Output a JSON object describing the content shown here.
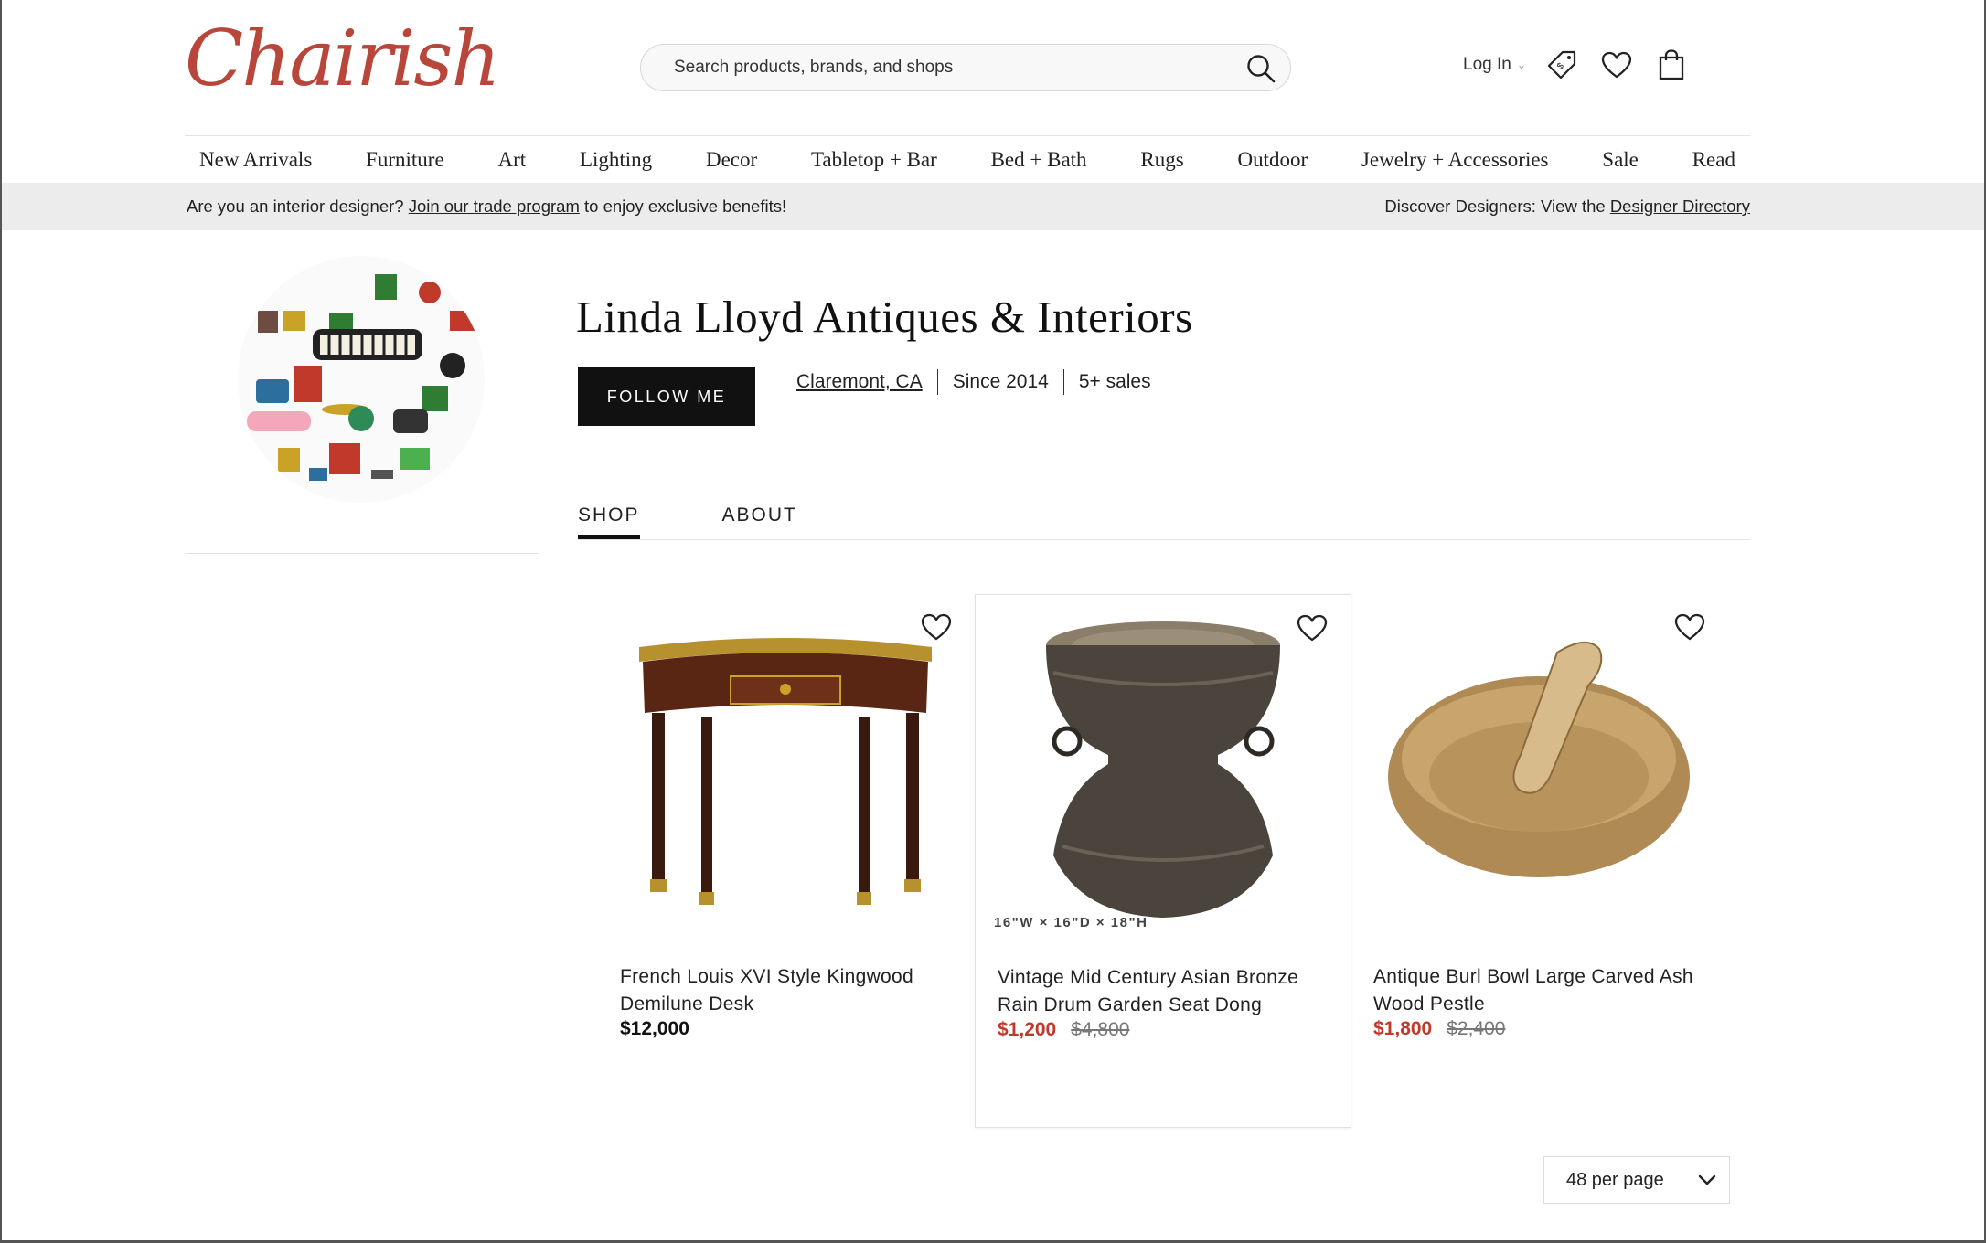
{
  "brand": {
    "logo_text": "Chairish",
    "accent_color": "#b8463a"
  },
  "search": {
    "placeholder": "Search products, brands, and shops"
  },
  "account": {
    "login_label": "Log In"
  },
  "nav": {
    "items": [
      "New Arrivals",
      "Furniture",
      "Art",
      "Lighting",
      "Decor",
      "Tabletop + Bar",
      "Bed + Bath",
      "Rugs",
      "Outdoor",
      "Jewelry + Accessories",
      "Sale",
      "Read"
    ]
  },
  "trade_banner": {
    "left_prefix": "Are you an interior designer? ",
    "left_link": "Join our trade program",
    "left_suffix": " to enjoy exclusive benefits!",
    "right_prefix": "Discover Designers: View the ",
    "right_link": "Designer Directory"
  },
  "shop": {
    "name": "Linda Lloyd Antiques & Interiors",
    "follow_label": "FOLLOW ME",
    "location": "Claremont, CA",
    "since": "Since 2014",
    "sales": "5+ sales"
  },
  "tabs": [
    {
      "label": "SHOP",
      "active": true
    },
    {
      "label": "ABOUT",
      "active": false
    }
  ],
  "products": [
    {
      "title": "French Louis XVI Style Kingwood Demilune Desk",
      "price": "$12,000",
      "original_price": "",
      "dimensions": ""
    },
    {
      "title": "Vintage Mid Century Asian Bronze Rain Drum Garden Seat Dong",
      "price": "$1,200",
      "original_price": "$4,800",
      "dimensions": "16\"W × 16\"D × 18\"H"
    },
    {
      "title": "Antique Burl Bowl Large Carved Ash Wood Pestle",
      "price": "$1,800",
      "original_price": "$2,400",
      "dimensions": ""
    }
  ],
  "pagination": {
    "per_page": "48 per page"
  }
}
